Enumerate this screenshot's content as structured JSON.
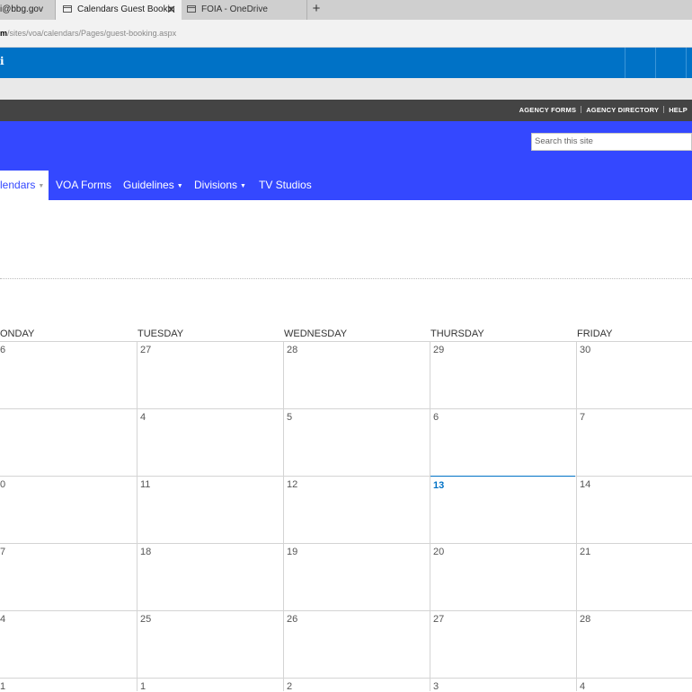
{
  "browser": {
    "tabs": [
      {
        "label": "i@bbg.gov"
      },
      {
        "label": "Calendars Guest Bookin",
        "close": "✕"
      },
      {
        "label": "FOIA - OneDrive"
      }
    ],
    "new_tab": "+",
    "url_prefix": "m",
    "url_path": "/sites/voa/calendars/Pages/guest-booking.aspx"
  },
  "suitebar": {
    "accent": "#0072c6",
    "glyph": "ℹ"
  },
  "utility": {
    "links": [
      "AGENCY FORMS",
      "AGENCY DIRECTORY",
      "HELP"
    ]
  },
  "header": {
    "color": "#3448ff",
    "search_placeholder": "Search this site"
  },
  "nav": {
    "items": [
      {
        "label": "lendars",
        "caret": "▼"
      },
      {
        "label": "VOA Forms"
      },
      {
        "label": "Guidelines",
        "caret": "▼"
      },
      {
        "label": "Divisions",
        "caret": "▼"
      },
      {
        "label": "TV Studios"
      }
    ]
  },
  "calendar": {
    "days": [
      "ONDAY",
      "TUESDAY",
      "WEDNESDAY",
      "THURSDAY",
      "FRIDAY"
    ],
    "weeks": [
      [
        "6",
        "27",
        "28",
        "29",
        "30"
      ],
      [
        "",
        "4",
        "5",
        "6",
        "7"
      ],
      [
        "0",
        "11",
        "12",
        "13",
        "14"
      ],
      [
        "7",
        "18",
        "19",
        "20",
        "21"
      ],
      [
        "4",
        "25",
        "26",
        "27",
        "28"
      ],
      [
        "1",
        "1",
        "2",
        "3",
        "4"
      ]
    ],
    "today": "13",
    "today_color": "#0072c6"
  }
}
